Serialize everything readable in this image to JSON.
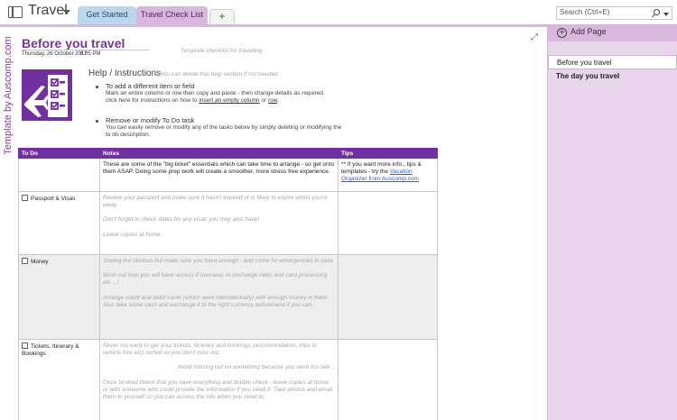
{
  "notebook": {
    "title": "Travel"
  },
  "tabs": [
    {
      "label": "Get Started"
    },
    {
      "label": "Travel Check List"
    },
    {
      "label": "+"
    }
  ],
  "search": {
    "placeholder": "Search (Ctrl+E)"
  },
  "right_panel": {
    "add_page_label": "Add Page",
    "pages": [
      "Before you travel",
      "The day you travel"
    ]
  },
  "page": {
    "brand_vertical": "Template by Auscomp.com",
    "title": "Before you travel",
    "date": "Thursday, 26 October 2017",
    "time": "6:05 PM",
    "template_note": "Template checklist for travelling",
    "help": {
      "heading": "Help / Instructions",
      "note": "- You can delete this help section if not needed",
      "items": [
        {
          "title": "To add a different item or field",
          "line1": "Mark an entire column or row then copy and paste - then change details as required.",
          "line2_prefix": "click here for instructions on how to ",
          "line2_link1": "insert an empty column",
          "line2_mid": " or ",
          "line2_link2": "row",
          "line2_suffix": "."
        },
        {
          "title": "Remove or modify To Do task",
          "line1": "You can easily remove or modify any of the tasks below by simply deleting or modifying the",
          "line2": "to do description."
        }
      ]
    }
  },
  "table": {
    "headers": {
      "todo": "To Do",
      "notes": "Notes",
      "tips": "Tips"
    },
    "intro": {
      "notes": "These are some of the \"big ticket\" essentials which can take time to arrange - so get onto them ASAP. Doing some prep work will create a smoother, more stress free experience.",
      "tips_prefix": "** If you want more info., tips & templates - try the ",
      "tips_link": "Vacation Organizer from Auscomp.com"
    },
    "rows": [
      {
        "todo": "Passport & Visas",
        "notes": [
          "Review your passport and make sure it hasn't expired or is likely to expire whilst you're away.",
          "Don't forget to check dates for any visas you may also have!",
          "Leave copies at home."
        ]
      },
      {
        "todo": "Money",
        "notes": [
          "Stating the obvious but make sure you have enough - and some for emergencies in case.",
          "Work out how you will have access if overseas re exchange rates and card processing etc ...!",
          "Arrange credit and debit cards (which work internationally) with enough money in them. Also take some cash and exchange it to the right currency beforehand if you can."
        ]
      },
      {
        "todo": "Tickets, Itinerary & Bookings",
        "notes": [
          "Never too early to get your tickets, itinerary and bookings (accommodation, trips or vehicle hire etc) sorted so you don't miss out.",
          "Avoid missing out on something because you were too late ..",
          "Once booked check that you have everything and double check - leave copies at home or with someone who could provide the information if you need it. Take photos and email them to yourself so you can access the info when you need to."
        ]
      }
    ]
  },
  "colors": {
    "accent_purple": "#7030a0",
    "title_purple": "#7a3591",
    "tab_purple": "#d9b7de",
    "tab_blue": "#bcd6ee",
    "panel_bg": "#e8d5ec"
  }
}
